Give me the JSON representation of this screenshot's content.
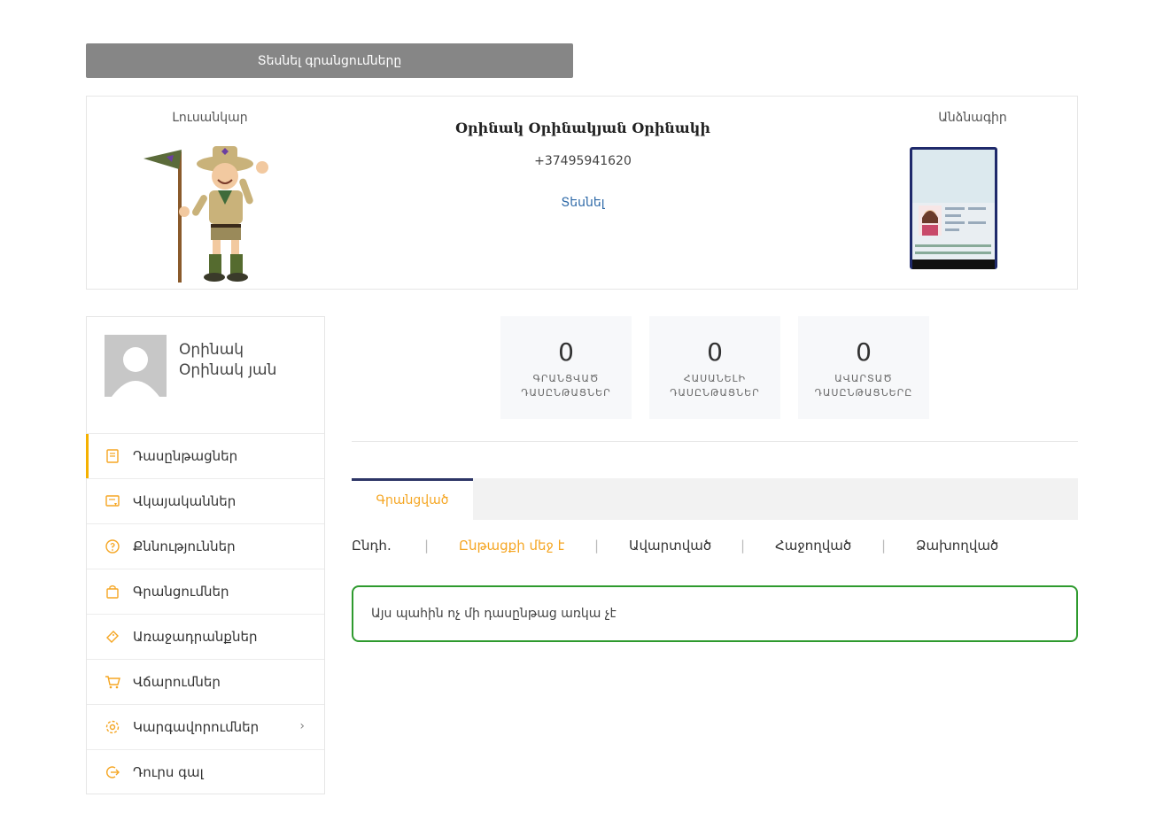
{
  "top_button": {
    "label": "Տեսնել գրանցումները"
  },
  "profile": {
    "photo_label": "Լուսանկար",
    "passport_label": "Անձնագիր",
    "name": "Օրինակ Օրինակյան Օրինակի",
    "phone": "+37495941620",
    "view_link": "Տեսնել"
  },
  "sidebar": {
    "user_name": "Օրինակ Օրինակ յան",
    "items": [
      {
        "label": "Դասընթացներ",
        "icon": "book-icon"
      },
      {
        "label": "Վկայականներ",
        "icon": "certificate-icon"
      },
      {
        "label": "Քննություններ",
        "icon": "question-circle-icon"
      },
      {
        "label": "Գրանցումներ",
        "icon": "bag-icon"
      },
      {
        "label": "Առաջադրանքներ",
        "icon": "ticket-icon"
      },
      {
        "label": "Վճարումներ",
        "icon": "cart-icon"
      },
      {
        "label": "Կարգավորումներ",
        "icon": "gear-icon"
      },
      {
        "label": "Դուրս գալ",
        "icon": "logout-icon"
      }
    ],
    "accent_color": "#f5b100"
  },
  "stats": [
    {
      "value": "0",
      "label": "ԳՐԱՆՑՎԱԾ ԴԱՍԸՆԹԱՑՆԵՐ"
    },
    {
      "value": "0",
      "label": "ՀԱՍԱՆԵԼԻ ԴԱՍԸՆԹԱՑՆԵՐ"
    },
    {
      "value": "0",
      "label": "ԱՎԱՐՏԱԾ ԴԱՍԸՆԹԱՑՆԵՐԸ"
    }
  ],
  "tabs": [
    {
      "label": "Գրանցված"
    }
  ],
  "filters": [
    {
      "label": "Ընդհ."
    },
    {
      "label": "Ընթացքի մեջ է"
    },
    {
      "label": "Ավարտված"
    },
    {
      "label": "Հաջողված"
    },
    {
      "label": "Ձախողված"
    }
  ],
  "notice": {
    "text": "Այս պահին ոչ մի դասընթաց առկա չէ"
  },
  "colors": {
    "accent_orange": "#f5a623",
    "success_green": "#2e9a2e",
    "tab_border": "#2d3566",
    "link_blue": "#2f6aa8"
  }
}
